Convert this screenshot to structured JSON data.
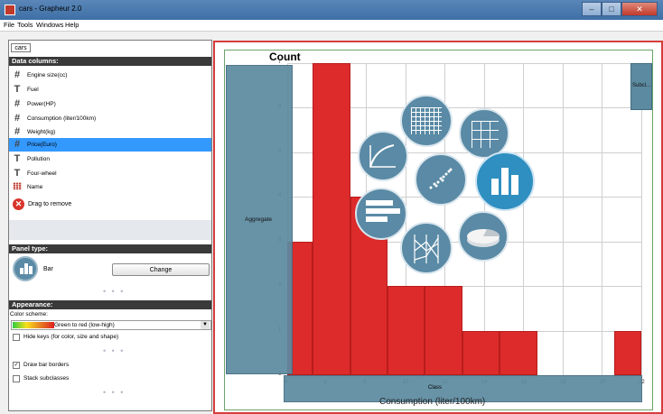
{
  "window": {
    "title": "cars - Grapheur 2.0"
  },
  "menu": [
    "File",
    "Tools",
    "Windows",
    "Help"
  ],
  "tab_label": "cars",
  "data_columns": {
    "header": "Data columns:",
    "items": [
      {
        "label": "Engine size(cc)",
        "type_icon": "#"
      },
      {
        "label": "Fuel",
        "type_icon": "T"
      },
      {
        "label": "Power(HP)",
        "type_icon": "#"
      },
      {
        "label": "Consumption (liter/100km)",
        "type_icon": "#"
      },
      {
        "label": "Weight(kg)",
        "type_icon": "#"
      },
      {
        "label": "Price(Euro)",
        "type_icon": "#",
        "selected": true
      },
      {
        "label": "Pollution",
        "type_icon": "T"
      },
      {
        "label": "Four-wheel",
        "type_icon": "T"
      },
      {
        "label": "Name",
        "type_icon": "table"
      }
    ],
    "drag_remove": "Drag to remove"
  },
  "panel_type": {
    "header": "Panel type:",
    "type": "Bar",
    "change_button": "Change",
    "dots": "• • •"
  },
  "appearance": {
    "header": "Appearance:",
    "color_scheme_label": "Color scheme:",
    "color_scheme_value": "Green to red (low-high)",
    "hide_keys": "Hide keys (for color, size and shape)",
    "draw_bar_borders": "Draw bar borders",
    "stack_subclasses": "Stack subclasses",
    "draw_bar_borders_checked": true,
    "stack_subclasses_checked": false,
    "hide_keys_checked": false
  },
  "chart_labels": {
    "count": "Count",
    "aggregate": "Aggregate",
    "subclass": "Subcl...",
    "class": "Class",
    "xlabel": "Consumption (liter/100km)"
  },
  "chart_data": {
    "type": "bar",
    "title": "",
    "xlabel": "Consumption (liter/100km)",
    "ylabel": "Count",
    "ylim": [
      0,
      7
    ],
    "xlim": [
      4,
      22
    ],
    "x_ticks": [
      "4",
      "6",
      "8",
      "10",
      "12",
      "14",
      "16",
      "18",
      "20",
      "22"
    ],
    "y_ticks": [
      "0",
      "1",
      "2",
      "3",
      "4",
      "5",
      "6",
      "7"
    ],
    "bins": [
      {
        "x0": 4,
        "x1": 5.3,
        "value": 3
      },
      {
        "x0": 5.3,
        "x1": 7.2,
        "value": 7
      },
      {
        "x0": 7.2,
        "x1": 9.1,
        "value": 4
      },
      {
        "x0": 9.1,
        "x1": 11.0,
        "value": 2
      },
      {
        "x0": 11.0,
        "x1": 12.9,
        "value": 2
      },
      {
        "x0": 12.9,
        "x1": 14.8,
        "value": 1
      },
      {
        "x0": 14.8,
        "x1": 16.7,
        "value": 1
      },
      {
        "x0": 20.6,
        "x1": 22,
        "value": 1
      }
    ],
    "grid": true,
    "bar_color": "#dd2a2a"
  },
  "chart_type_menu": [
    "grid-heatmap",
    "small-multiples",
    "line-chart",
    "scatter-plot",
    "bar-chart",
    "horizontal-bar",
    "parallel-coordinates",
    "pie-chart"
  ]
}
